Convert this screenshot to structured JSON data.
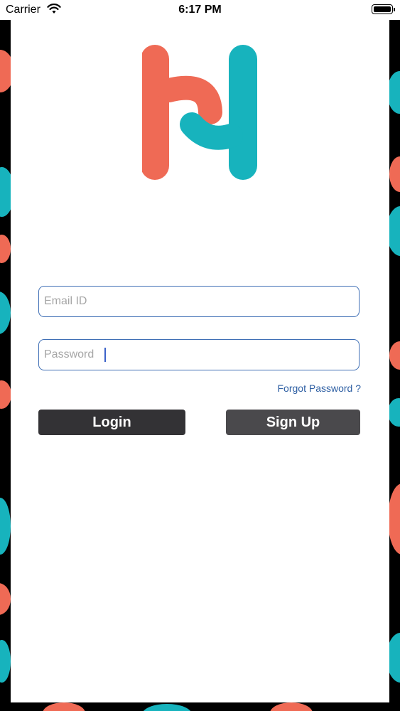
{
  "status_bar": {
    "carrier": "Carrier",
    "time": "6:17 PM"
  },
  "brand": {
    "logo_icon": "h-logo-icon",
    "colors": {
      "coral": "#ef6a55",
      "teal": "#17b3bd"
    }
  },
  "form": {
    "email_placeholder": "Email ID",
    "password_placeholder": "Password",
    "forgot_label": "Forgot Password ?",
    "login_label": "Login",
    "signup_label": "Sign Up"
  }
}
